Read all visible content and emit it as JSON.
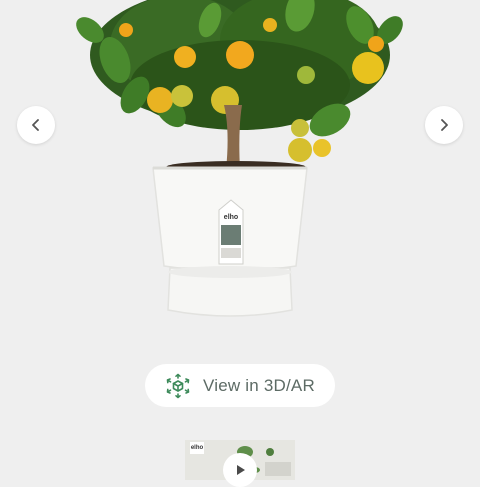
{
  "product_image": {
    "alt": "Citrus tree in white elho pot"
  },
  "pot_label": {
    "brand": "elho"
  },
  "carousel": {
    "prev_icon": "chevron-left-icon",
    "next_icon": "chevron-right-icon"
  },
  "ar_button": {
    "icon": "cube-3d-ar-icon",
    "label": "View in 3D/AR"
  },
  "video_thumbnail": {
    "logo_text": "elho",
    "play_icon": "play-icon"
  },
  "colors": {
    "background": "#efefef",
    "button_bg": "#ffffff",
    "ar_icon_green": "#3d8a5a",
    "label_text": "#5d6b65"
  }
}
